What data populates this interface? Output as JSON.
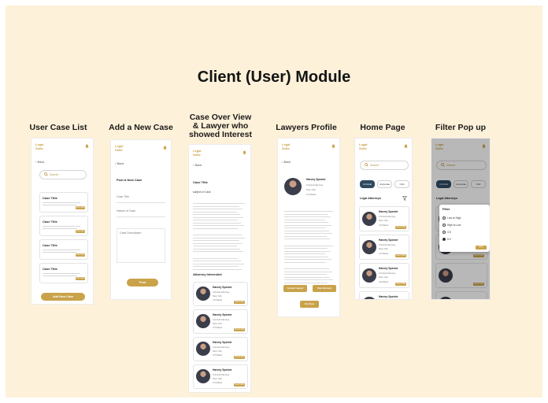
{
  "page": {
    "title": "Client (User) Module"
  },
  "columns": [
    {
      "title": "User Case List"
    },
    {
      "title": "Add a New Case"
    },
    {
      "title": "Case Over View & Lawyer who showed Interest"
    },
    {
      "title": "Lawyers Profile"
    },
    {
      "title": "Home Page"
    },
    {
      "title": "Filter Pop up"
    }
  ],
  "app": {
    "logo": "Legal Suite",
    "back_label": "Back",
    "search_placeholder": "Search",
    "accent": "#c9a24a",
    "dark_chip": "#2e4a61",
    "bell_icon": "bell-icon"
  },
  "user_case_list": {
    "cards": [
      {
        "title": "Case Title",
        "button": "View Case"
      },
      {
        "title": "Case Title",
        "button": "View Case"
      },
      {
        "title": "Case Title",
        "button": "View Case"
      },
      {
        "title": "Case Title",
        "button": "View Case"
      }
    ],
    "add_button": "Add New Case"
  },
  "add_case": {
    "heading": "Post A New Case",
    "fields": [
      "Case Title",
      "Nature of Case",
      "Case Description"
    ],
    "submit": "Post"
  },
  "case_overview": {
    "title": "Case Title",
    "subtitle": "subject of Case",
    "section": "Attorney Interested"
  },
  "lawyer_card": {
    "name": "Harvey Specter",
    "role": "Criminal Attorney",
    "location": "New York",
    "rating": "4.5 Rated",
    "button": "View Profile"
  },
  "lawyers_profile": {
    "buttons": [
      "Contact Lawyer",
      "View Reviews"
    ],
    "hire": "Hire Now"
  },
  "home": {
    "chips": [
      "Criminal",
      "Corporate",
      "Civil"
    ],
    "section": "Legal Attorneys"
  },
  "filter_popup": {
    "title": "Filter",
    "options": [
      {
        "label": "Low to High",
        "selected": false
      },
      {
        "label": "High to Low",
        "selected": false
      },
      {
        "label": "4.5",
        "selected": false
      },
      {
        "label": "5.0",
        "selected": true
      }
    ],
    "apply": "Apply"
  }
}
